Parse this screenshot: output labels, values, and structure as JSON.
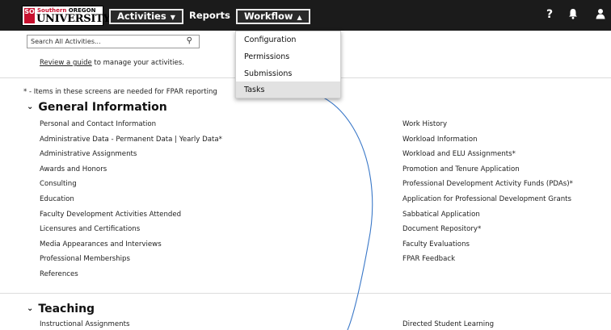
{
  "logo": {
    "line1_a": "Southern",
    "line1_b": "OREGON",
    "line2": "UNIVERSITY",
    "seal": "SO"
  },
  "nav": {
    "activities": "Activities",
    "reports": "Reports",
    "workflow": "Workflow"
  },
  "icons": {
    "help": "question-icon",
    "notifications": "bell-icon",
    "user": "user-icon"
  },
  "search": {
    "placeholder": "Search All Activities..."
  },
  "guide": {
    "link": "Review a guide",
    "rest": " to manage your activities."
  },
  "fpar_note": "* - Items in these screens are needed for FPAR reporting",
  "workflow_menu": [
    "Configuration",
    "Permissions",
    "Submissions",
    "Tasks"
  ],
  "general": {
    "title": "General Information",
    "left": [
      "Personal and Contact Information",
      "Administrative Data - Permanent Data | Yearly Data*",
      "Administrative Assignments",
      "Awards and Honors",
      "Consulting",
      "Education",
      "Faculty Development Activities Attended",
      "Licensures and Certifications",
      "Media Appearances and Interviews",
      "Professional Memberships",
      "References"
    ],
    "right": [
      "Work History",
      "Workload Information",
      "Workload and ELU Assignments*",
      "Promotion and Tenure Application",
      "Professional Development Activity Funds (PDAs)*",
      "Application for Professional Development Grants",
      "Sabbatical Application",
      "Document Repository*",
      "Faculty Evaluations",
      "FPAR Feedback"
    ]
  },
  "teaching": {
    "title": "Teaching",
    "left": [
      "Instructional Assignments"
    ],
    "right": [
      "Directed Student Learning"
    ]
  },
  "colors": {
    "topbar": "#1b1b1b",
    "menu_highlight": "#e2e2e2",
    "annotation_line": "#3a78c8"
  }
}
